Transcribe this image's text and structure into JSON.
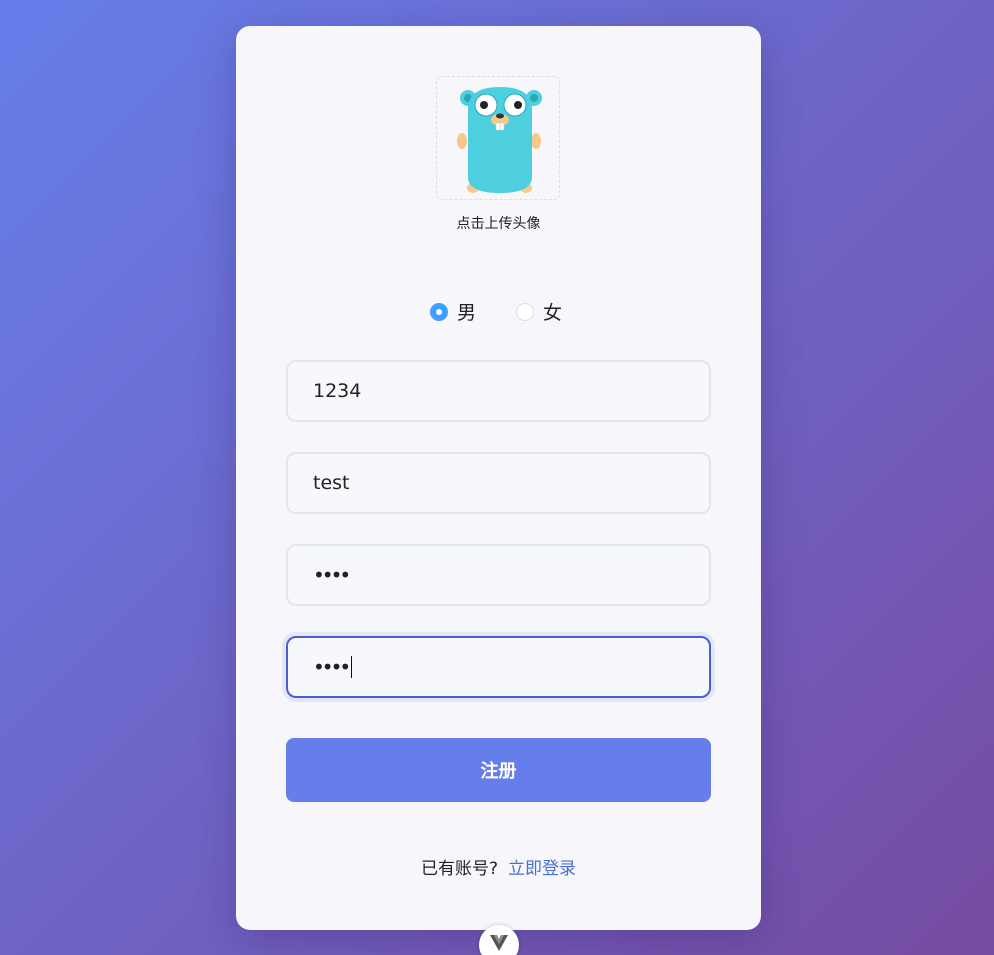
{
  "avatar": {
    "caption": "点击上传头像",
    "image": "gopher-mascot"
  },
  "gender": {
    "options": [
      {
        "label": "男",
        "checked": true
      },
      {
        "label": "女",
        "checked": false
      }
    ]
  },
  "form": {
    "username_value": "1234",
    "nickname_value": "test",
    "password_value": "••••",
    "confirm_password_value": "••••",
    "submit_label": "注册"
  },
  "footer": {
    "prompt": "已有账号?",
    "login_link": "立即登录"
  },
  "colors": {
    "accent": "#667eea",
    "link": "#4a6fd0",
    "radio_checked": "#409eff"
  },
  "devtools": {
    "icon": "vue-logo-icon"
  }
}
